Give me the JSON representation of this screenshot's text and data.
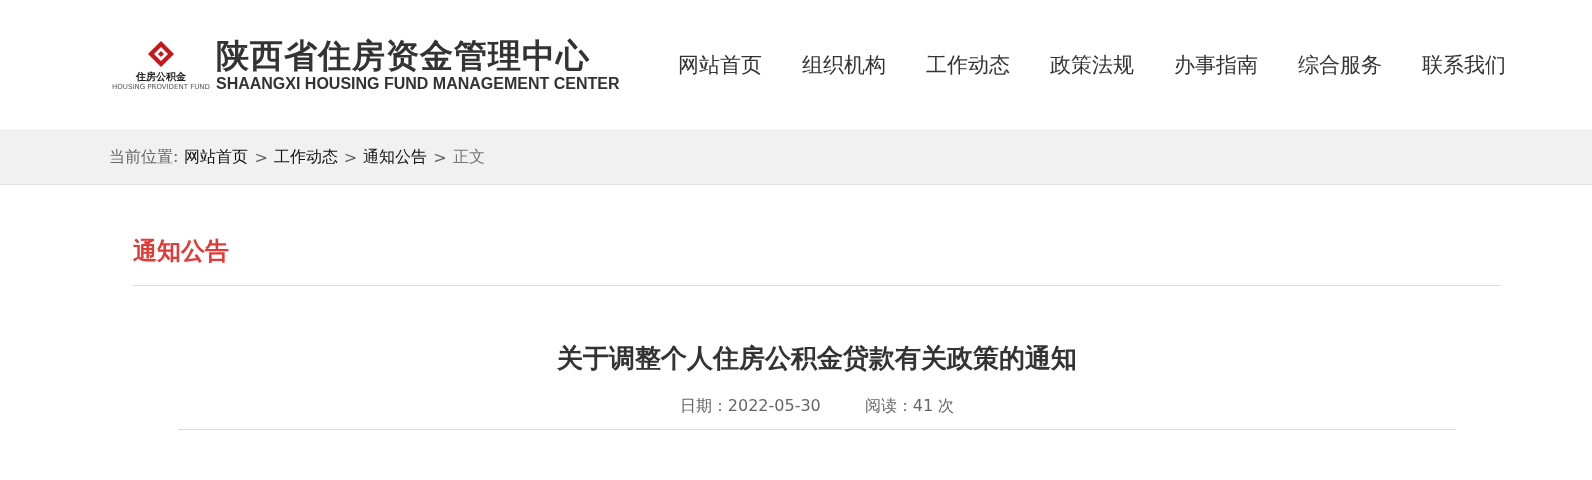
{
  "logo": {
    "title": "陕西省住房资金管理中心",
    "subtitle": "SHAANGXI HOUSING FUND MANAGEMENT CENTER",
    "mark_text": "住房公积金",
    "mark_subtext": "HOUSING PROVIDENT FUND"
  },
  "nav": [
    {
      "label": "网站首页"
    },
    {
      "label": "组织机构"
    },
    {
      "label": "工作动态"
    },
    {
      "label": "政策法规"
    },
    {
      "label": "办事指南"
    },
    {
      "label": "综合服务"
    },
    {
      "label": "联系我们"
    }
  ],
  "breadcrumb": {
    "prefix": "当前位置:",
    "separator": ">",
    "items": [
      {
        "label": "网站首页",
        "current": false
      },
      {
        "label": "工作动态",
        "current": false
      },
      {
        "label": "通知公告",
        "current": false
      },
      {
        "label": "正文",
        "current": true
      }
    ]
  },
  "section_title": "通知公告",
  "article": {
    "title": "关于调整个人住房公积金贷款有关政策的通知",
    "date": "日期：2022-05-30",
    "views": "阅读：41 次"
  }
}
